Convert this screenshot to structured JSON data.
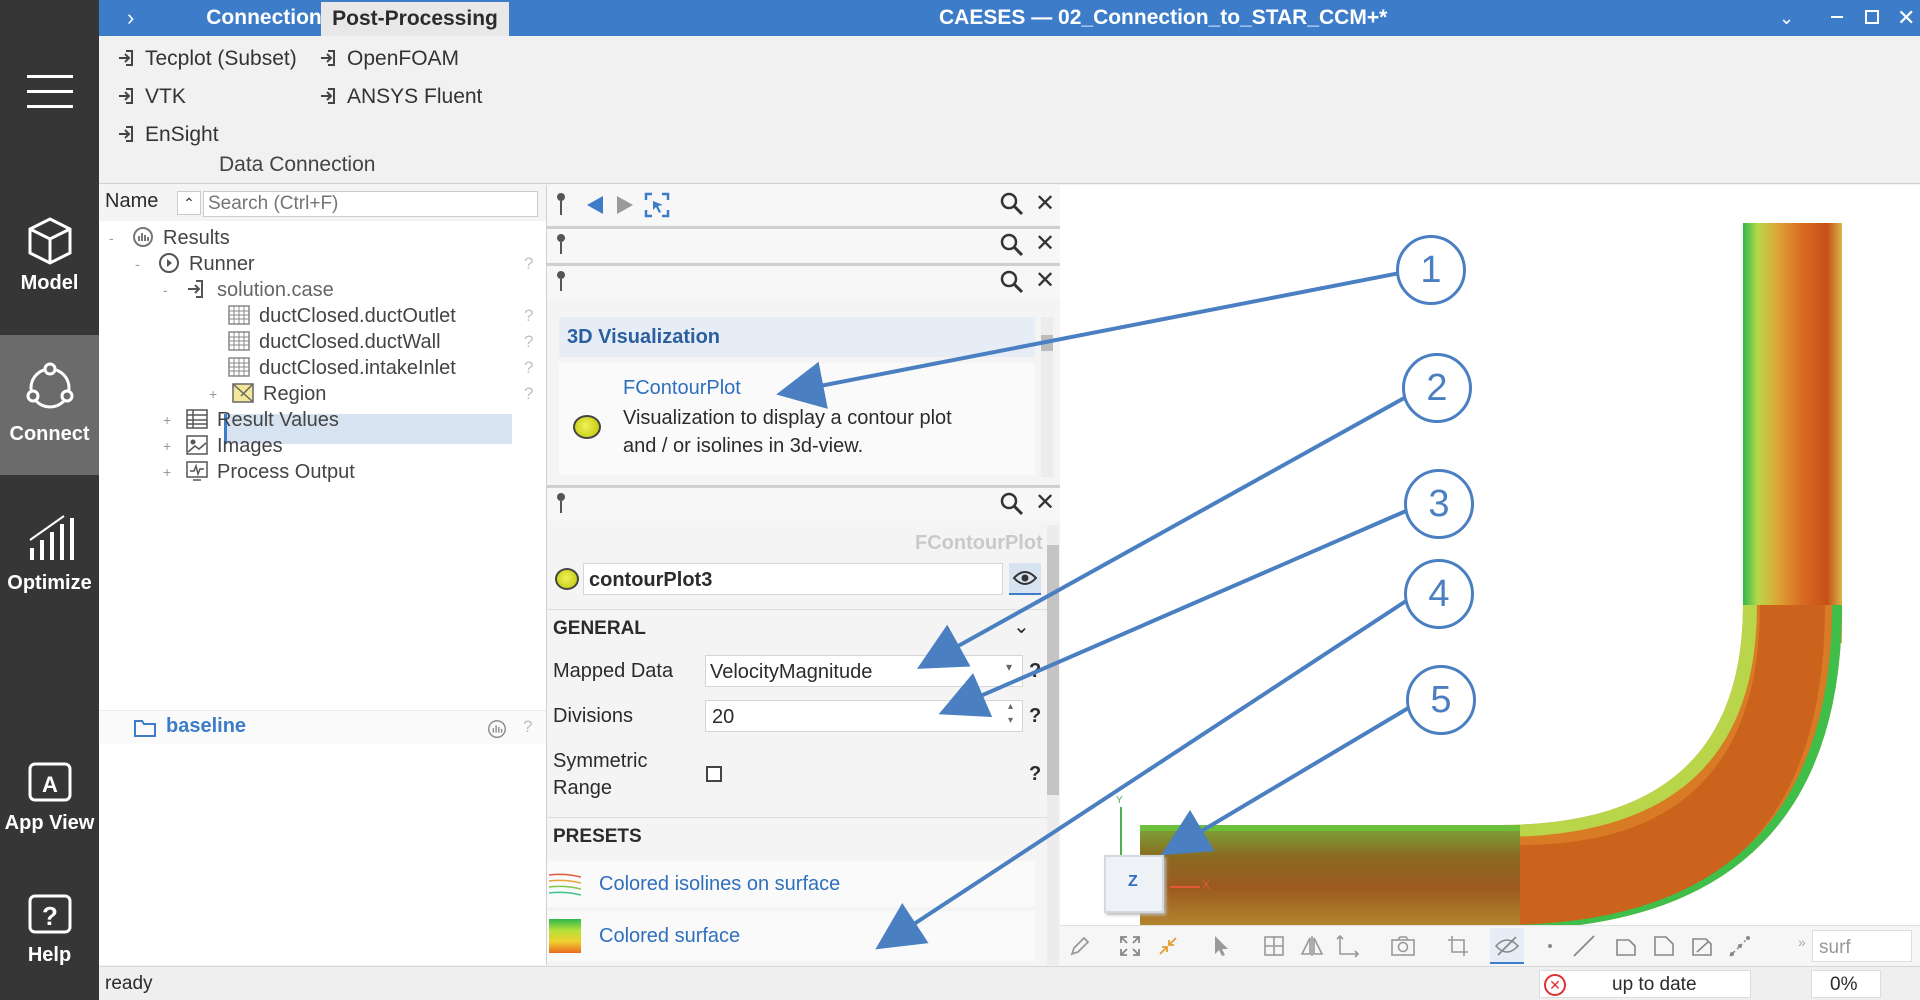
{
  "nav": {
    "model": "Model",
    "connect": "Connect",
    "optimize": "Optimize",
    "app_view": "App View",
    "help": "Help"
  },
  "topbar": {
    "tabs": [
      "Connection",
      "Post-Processing"
    ],
    "title": "CAESES  —  02_Connection_to_STAR_CCM+*"
  },
  "ribbon": {
    "items": [
      "Tecplot (Subset)",
      "OpenFOAM",
      "VTK",
      "ANSYS Fluent",
      "EnSight"
    ],
    "group_label": "Data Connection"
  },
  "tree": {
    "header_name": "Name",
    "search_placeholder": "Search (Ctrl+F)",
    "rows": [
      "Results",
      "Runner",
      "solution.case",
      "ductClosed.ductOutlet",
      "ductClosed.ductWall",
      "ductClosed.intakeInlet",
      "Region",
      "Result Values",
      "Images",
      "Process Output"
    ],
    "project": "baseline",
    "help_mark": "?"
  },
  "panel": {
    "section_3d": "3D Visualization",
    "fcontour_title": "FContourPlot",
    "fcontour_desc_1": "Visualization to display a contour plot",
    "fcontour_desc_2": "and / or isolines in 3d-view.",
    "type_label": "FContourPlot",
    "object_name": "contourPlot3",
    "general": "GENERAL",
    "mapped_data_label": "Mapped Data",
    "mapped_data_value": "VelocityMagnitude",
    "divisions_label": "Divisions",
    "divisions_value": "20",
    "symmetric_label_1": "Symmetric",
    "symmetric_label_2": "Range",
    "presets": "PRESETS",
    "preset_1": "Colored isolines on surface",
    "preset_2": "Colored surface",
    "help_mark": "?"
  },
  "viewport": {
    "axis_z": "Z",
    "axis_x": "X",
    "axis_y": "Y",
    "toolbar_search": "surf",
    "callouts": [
      "1",
      "2",
      "3",
      "4",
      "5"
    ]
  },
  "status": {
    "left": "ready",
    "state": "up to date",
    "progress": "0%"
  },
  "colors": {
    "brand_blue": "#3d7cc9",
    "nav_dark": "#363636",
    "callout_blue": "#4a7fc1"
  }
}
